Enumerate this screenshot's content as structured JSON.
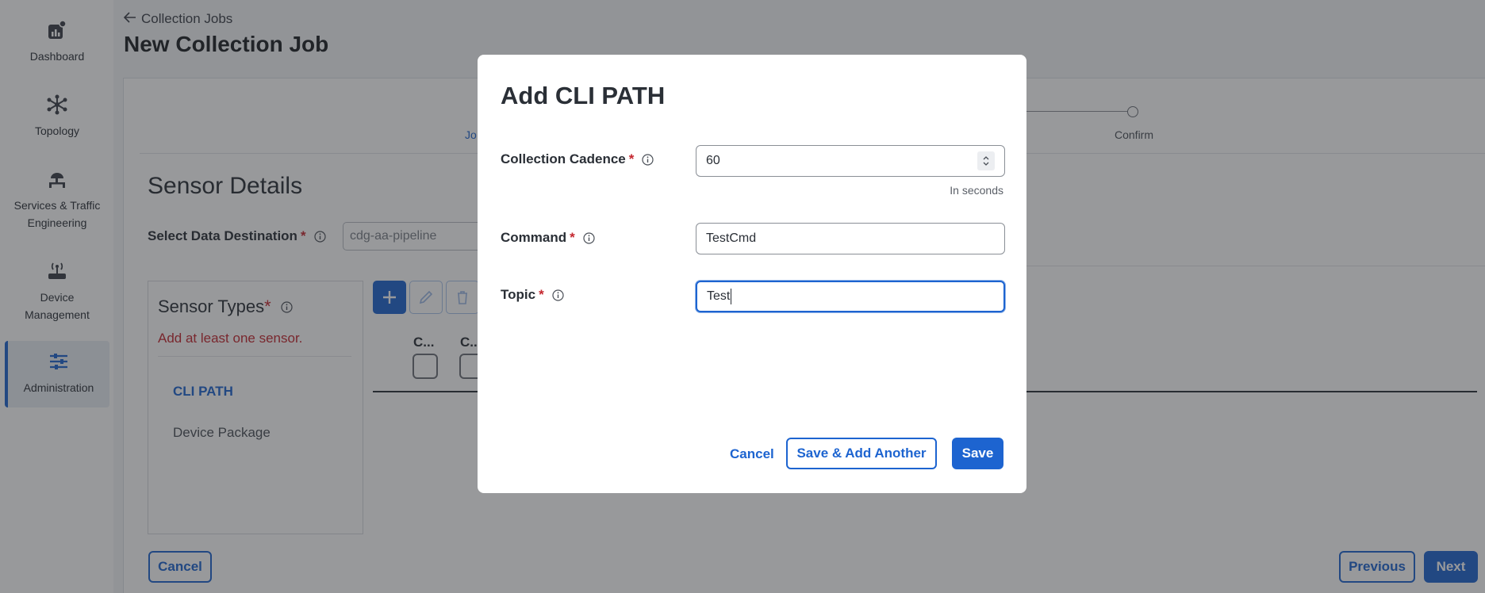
{
  "sidebar": {
    "items": [
      {
        "label": "Dashboard",
        "icon": "dashboard-icon"
      },
      {
        "label": "Topology",
        "icon": "topology-icon"
      },
      {
        "label": "Services & Traffic Engineering",
        "icon": "services-icon"
      },
      {
        "label": "Device Management",
        "icon": "device-icon"
      },
      {
        "label": "Administration",
        "icon": "administration-icon",
        "active": true
      }
    ]
  },
  "header": {
    "back_label": "Collection Jobs",
    "title": "New Collection Job"
  },
  "stepper": {
    "job_label": "Jo",
    "confirm_label": "Confirm"
  },
  "sensor_details": {
    "title": "Sensor Details",
    "destination_label": "Select Data Destination",
    "destination_value": "cdg-aa-pipeline",
    "sensor_types_title": "Sensor Types",
    "sensor_types_warning": "Add at least one sensor.",
    "sensor_types": [
      "CLI PATH",
      "Device Package"
    ],
    "columns": [
      "C...",
      "C..."
    ]
  },
  "footer": {
    "cancel_label": "Cancel",
    "previous_label": "Previous",
    "next_label": "Next"
  },
  "modal": {
    "title": "Add CLI PATH",
    "cadence_label": "Collection Cadence",
    "cadence_value": "60",
    "cadence_hint": "In seconds",
    "command_label": "Command",
    "command_value": "TestCmd",
    "topic_label": "Topic",
    "topic_value": "Test",
    "required_mark": "*",
    "cancel_label": "Cancel",
    "save_add_label": "Save & Add Another",
    "save_label": "Save"
  },
  "colors": {
    "accent": "#1d64d0",
    "required": "#c4262e"
  }
}
